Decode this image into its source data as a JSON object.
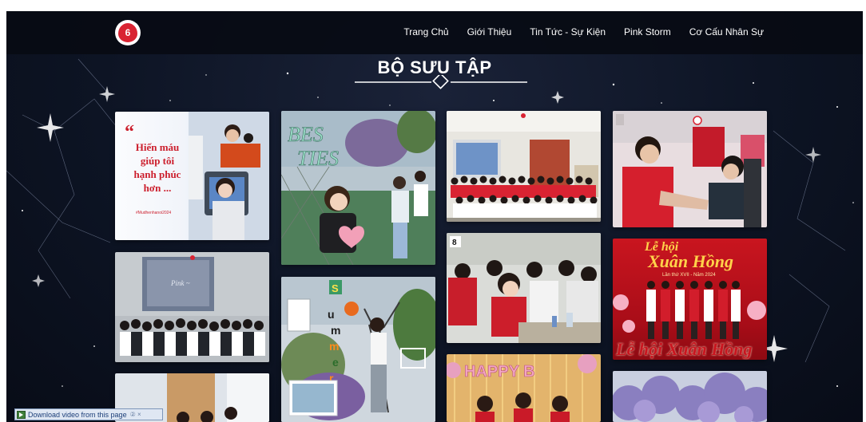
{
  "nav": {
    "logo_text": "6",
    "links": [
      "Trang Chủ",
      "Giới Thiệu",
      "Tin Tức - Sự Kiện",
      "Pink Storm",
      "Cơ Cấu Nhân Sự"
    ]
  },
  "section": {
    "title": "BỘ SƯU TẬP"
  },
  "gallery": {
    "quote": {
      "mark": "“",
      "lines": [
        "Hiến máu",
        "giúp tôi",
        "hạnh phúc",
        "hơn ..."
      ],
      "hashtag": "#Mudhenhanoi2024"
    },
    "festival": {
      "line1": "Lễ hội",
      "line2": "Xuân Hồng",
      "subtitle": "Lần thứ XVII - Năm 2024",
      "bottom": "Lễ hội Xuân Hồng"
    },
    "classroom_number": "8",
    "birthday": "HAPPY B"
  },
  "download_bar": {
    "label": "Download video from this page",
    "extra": "② ×"
  },
  "colors": {
    "brand_red": "#d92332",
    "background": "#0d1424",
    "nav_text": "#ffffff"
  }
}
